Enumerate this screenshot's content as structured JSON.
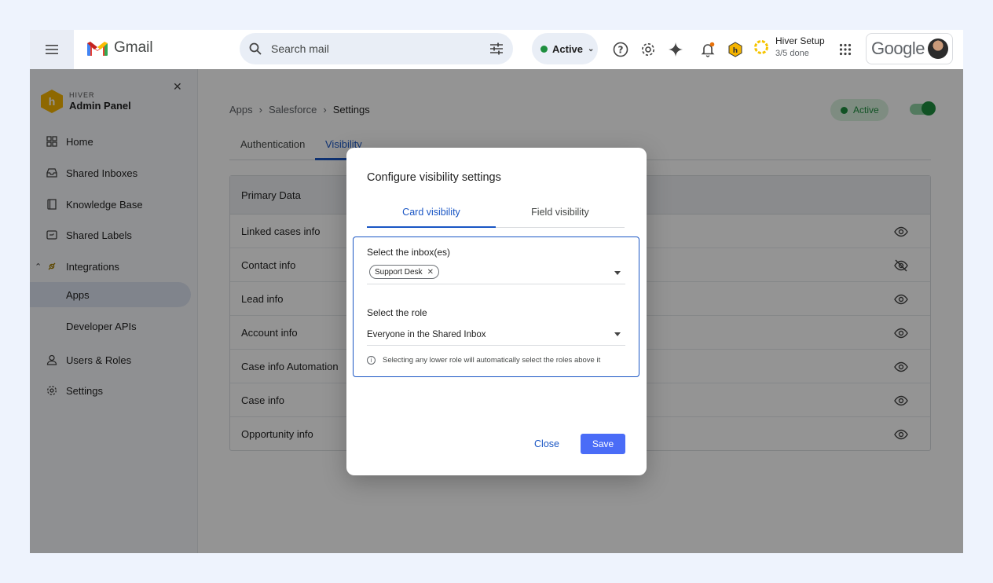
{
  "topbar": {
    "app_name": "Gmail",
    "search_placeholder": "Search mail",
    "status": "Active",
    "setup_title": "Hiver Setup",
    "setup_progress": "3/5 done",
    "google_label": "Google"
  },
  "sidebar": {
    "brand_small": "HIVER",
    "brand_big": "Admin Panel",
    "items": [
      {
        "label": "Home",
        "icon": "grid-icon"
      },
      {
        "label": "Shared Inboxes",
        "icon": "inbox-icon"
      },
      {
        "label": "Knowledge Base",
        "icon": "book-icon"
      },
      {
        "label": "Shared Labels",
        "icon": "label-icon"
      },
      {
        "label": "Integrations",
        "icon": "plug-icon"
      },
      {
        "label": "Apps",
        "icon": ""
      },
      {
        "label": "Developer APIs",
        "icon": ""
      },
      {
        "label": "Users & Roles",
        "icon": "user-icon"
      },
      {
        "label": "Settings",
        "icon": "gear-icon"
      }
    ]
  },
  "main": {
    "breadcrumb": [
      "Apps",
      "Salesforce",
      "Settings"
    ],
    "status": "Active",
    "tabs": [
      "Authentication",
      "Visibility"
    ],
    "table_header": "Primary Data",
    "rows": [
      {
        "label": "Linked cases info",
        "icon": "eye-icon"
      },
      {
        "label": "Contact info",
        "icon": "eye-off-icon"
      },
      {
        "label": "Lead info",
        "icon": "eye-icon"
      },
      {
        "label": "Account info",
        "icon": "eye-icon"
      },
      {
        "label": "Case info Automation",
        "icon": "eye-icon"
      },
      {
        "label": "Case info",
        "icon": "eye-icon"
      },
      {
        "label": "Opportunity info",
        "icon": "eye-icon"
      }
    ]
  },
  "modal": {
    "title": "Configure visibility settings",
    "tabs": [
      "Card visibility",
      "Field visibility"
    ],
    "inbox_label": "Select the inbox(es)",
    "inbox_chip": "Support Desk",
    "role_label": "Select the role",
    "role_value": "Everyone in the Shared Inbox",
    "hint": "Selecting any lower role will automatically select the roles above it",
    "close_label": "Close",
    "save_label": "Save"
  },
  "colors": {
    "accent": "#1a56c4",
    "save_button": "#4a6cf7",
    "active_green": "#1e8e3e",
    "brand_yellow": "#f5b400"
  }
}
